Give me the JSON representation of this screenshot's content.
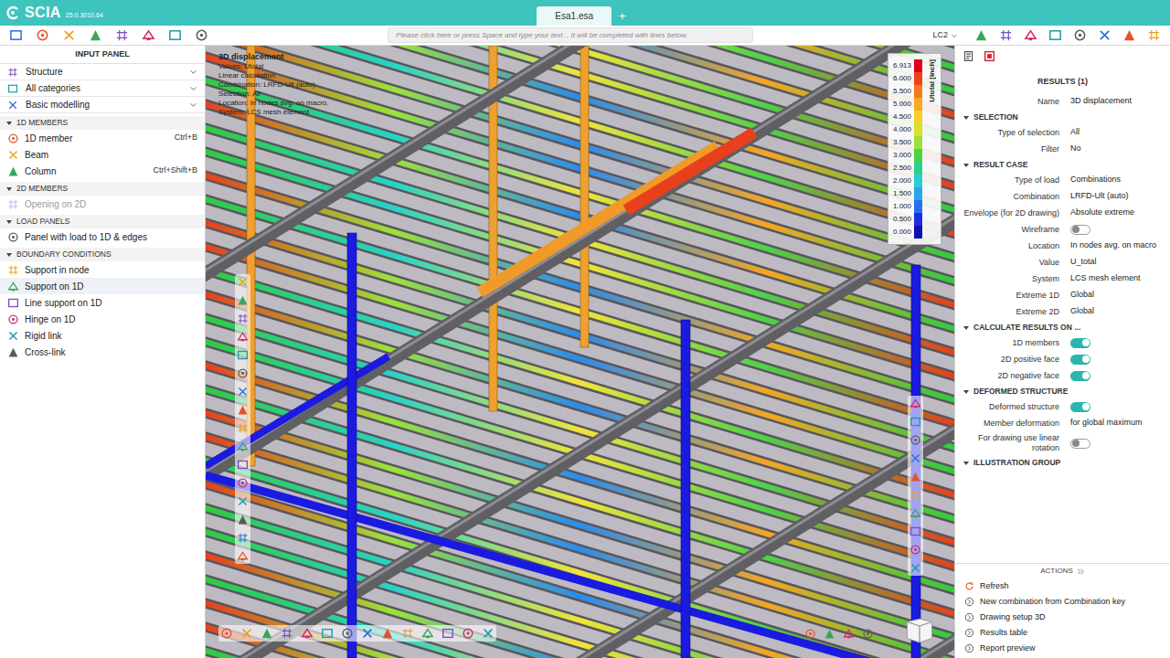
{
  "top_bar": {
    "logo": "SCIA",
    "version": "25.0.3010.64",
    "tabs": [
      {
        "label": "Esa1.esa",
        "selected": true
      }
    ],
    "add_tab": "+"
  },
  "toolbar": {
    "command_placeholder": "Please click here or press Space and type your text... It will be completed with lines below.",
    "load_case": "LC2"
  },
  "input_panel": {
    "title": "INPUT PANEL",
    "filters": [
      "Structure",
      "All categories",
      "Basic modelling"
    ],
    "sections": [
      {
        "title": "1D MEMBERS",
        "expanded": true,
        "items": [
          {
            "label": "1D member",
            "shortcut": "Ctrl+B",
            "disabled": false,
            "selected": false
          },
          {
            "label": "Beam",
            "disabled": false,
            "selected": false
          },
          {
            "label": "Column",
            "shortcut": "Ctrl+Shift+B",
            "disabled": false,
            "selected": false
          }
        ]
      },
      {
        "title": "2D MEMBERS",
        "expanded": true,
        "items": [
          {
            "label": "Opening on 2D",
            "disabled": true,
            "selected": false
          }
        ]
      },
      {
        "title": "LOAD PANELS",
        "expanded": true,
        "items": [
          {
            "label": "Panel with load to 1D & edges",
            "disabled": false,
            "selected": false
          }
        ]
      },
      {
        "title": "BOUNDARY CONDITIONS",
        "expanded": true,
        "items": [
          {
            "label": "Support in node",
            "disabled": false,
            "selected": false
          },
          {
            "label": "Support on 1D",
            "disabled": false,
            "selected": true
          },
          {
            "label": "Line support on 1D",
            "disabled": false,
            "selected": false
          },
          {
            "label": "Hinge on 1D",
            "disabled": false,
            "selected": false
          },
          {
            "label": "Rigid link",
            "disabled": false,
            "selected": false
          },
          {
            "label": "Cross-link",
            "disabled": false,
            "selected": false
          }
        ]
      }
    ]
  },
  "view": {
    "overlay": {
      "title": "3D displacement",
      "lines": [
        "Values: Utotal",
        "Linear calculation",
        "Combination: LRFD-Ult (auto)",
        "Selection: All",
        "Location: In nodes avg. on macro.",
        "System: LCS mesh element"
      ]
    },
    "legend": {
      "title": "Utotal [inch]",
      "ticks": [
        {
          "value": "6.913",
          "color": "#e0001b"
        },
        {
          "value": "6.000",
          "color": "#f0401a"
        },
        {
          "value": "5.500",
          "color": "#f57a1e"
        },
        {
          "value": "5.000",
          "color": "#f9a825"
        },
        {
          "value": "4.500",
          "color": "#f5d02a"
        },
        {
          "value": "4.000",
          "color": "#d8e030"
        },
        {
          "value": "3.500",
          "color": "#9ee03a"
        },
        {
          "value": "3.000",
          "color": "#4cd24a"
        },
        {
          "value": "2.500",
          "color": "#2ecf8a"
        },
        {
          "value": "2.000",
          "color": "#28cfd0"
        },
        {
          "value": "1.500",
          "color": "#2aa6e8"
        },
        {
          "value": "1.000",
          "color": "#2a6ef0"
        },
        {
          "value": "0.500",
          "color": "#1a2ee0"
        },
        {
          "value": "0.000",
          "color": "#1010b0"
        }
      ]
    }
  },
  "results_panel": {
    "title": "RESULTS (1)",
    "name": {
      "label": "Name",
      "value": "3D displacement"
    },
    "sections": [
      {
        "title": "SELECTION",
        "expanded": true,
        "rows": [
          {
            "kind": "value",
            "label": "Type of selection",
            "value": "All"
          },
          {
            "kind": "value",
            "label": "Filter",
            "value": "No"
          }
        ]
      },
      {
        "title": "RESULT CASE",
        "expanded": true,
        "rows": [
          {
            "kind": "value",
            "label": "Type of load",
            "value": "Combinations"
          },
          {
            "kind": "value",
            "label": "Combination",
            "value": "LRFD-Ult (auto)"
          },
          {
            "kind": "value",
            "label": "Envelope (for 2D drawing)",
            "value": "Absolute extreme"
          },
          {
            "kind": "toggle",
            "label": "Wireframe",
            "on": false
          },
          {
            "kind": "value",
            "label": "Location",
            "value": "In nodes avg. on macro"
          },
          {
            "kind": "value",
            "label": "Value",
            "value": "U_total"
          },
          {
            "kind": "value",
            "label": "System",
            "value": "LCS mesh element"
          },
          {
            "kind": "value",
            "label": "Extreme 1D",
            "value": "Global"
          },
          {
            "kind": "value",
            "label": "Extreme 2D",
            "value": "Global"
          }
        ]
      },
      {
        "title": "CALCULATE RESULTS ON ...",
        "expanded": true,
        "rows": [
          {
            "kind": "toggle",
            "label": "1D members",
            "on": true
          },
          {
            "kind": "toggle",
            "label": "2D positive face",
            "on": true
          },
          {
            "kind": "toggle",
            "label": "2D negative face",
            "on": true
          }
        ]
      },
      {
        "title": "DEFORMED STRUCTURE",
        "expanded": true,
        "rows": [
          {
            "kind": "toggle",
            "label": "Deformed structure",
            "on": true
          },
          {
            "kind": "value",
            "label": "Member deformation",
            "value": "for global maximum"
          },
          {
            "kind": "toggle",
            "label": "For drawing use linear rotation",
            "on": false
          }
        ]
      },
      {
        "title": "ILLUSTRATION GROUP",
        "expanded": true,
        "rows": []
      }
    ]
  },
  "actions": {
    "title": "ACTIONS",
    "items": [
      "Refresh",
      "New combination from Combination key",
      "Drawing setup 3D",
      "Results table",
      "Report preview"
    ]
  }
}
